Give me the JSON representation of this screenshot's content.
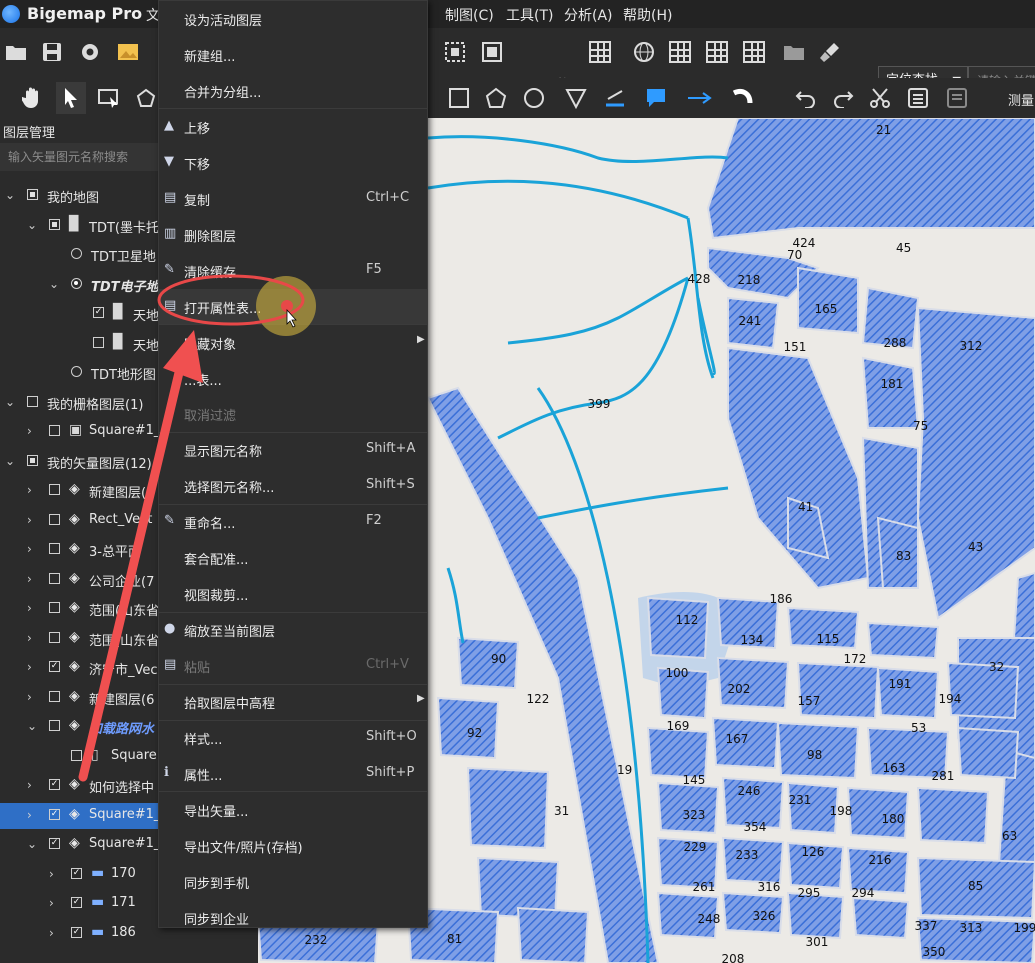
{
  "app": {
    "title": "Bigemap Pro",
    "file_menu_partial": "文"
  },
  "menubar": [
    "制图(C)",
    "工具(T)",
    "分析(A)",
    "帮助(H)"
  ],
  "toolbar": {
    "grid_label": "网格",
    "locate_label": "定位查找",
    "search_placeholder": "请输入关键",
    "measure_label": "测量"
  },
  "layer_panel": {
    "title": "图层管理",
    "search_placeholder": "输入矢量图元名称搜索",
    "rows": [
      {
        "label": "我的地图",
        "level": 0,
        "toggle": "down",
        "check": "partial",
        "icon": ""
      },
      {
        "label": "TDT(墨卡托",
        "level": 1,
        "toggle": "down",
        "check": "partial",
        "icon": "map"
      },
      {
        "label": "TDT卫星地",
        "level": 2,
        "toggle": "",
        "check": "radio",
        "icon": ""
      },
      {
        "label": "TDT电子地",
        "level": 2,
        "toggle": "down",
        "check": "radio-on",
        "icon": "",
        "style": "em"
      },
      {
        "label": "天地",
        "level": 3,
        "toggle": "",
        "check": "checked",
        "icon": "map"
      },
      {
        "label": "天地",
        "level": 3,
        "toggle": "",
        "check": "empty",
        "icon": "map"
      },
      {
        "label": "TDT地形图",
        "level": 2,
        "toggle": "",
        "check": "radio",
        "icon": ""
      },
      {
        "label": "我的栅格图层(1)",
        "level": 0,
        "toggle": "down",
        "check": "empty",
        "icon": ""
      },
      {
        "label": "Square#1_",
        "level": 1,
        "toggle": "right",
        "check": "empty",
        "icon": "img"
      },
      {
        "label": "我的矢量图层(12)",
        "level": 0,
        "toggle": "down",
        "check": "partial",
        "icon": ""
      },
      {
        "label": "新建图层(1",
        "level": 1,
        "toggle": "right",
        "check": "empty",
        "icon": "layers"
      },
      {
        "label": "Rect_Vect",
        "level": 1,
        "toggle": "right",
        "check": "empty",
        "icon": "layers"
      },
      {
        "label": "3-总平面",
        "level": 1,
        "toggle": "right",
        "check": "empty",
        "icon": "layers"
      },
      {
        "label": "公司企业(7",
        "level": 1,
        "toggle": "right",
        "check": "empty",
        "icon": "layers"
      },
      {
        "label": "范围(山东省",
        "level": 1,
        "toggle": "right",
        "check": "empty",
        "icon": "layers"
      },
      {
        "label": "范围(山东省",
        "level": 1,
        "toggle": "right",
        "check": "empty",
        "icon": "layers"
      },
      {
        "label": "济宁市_Vec",
        "level": 1,
        "toggle": "right",
        "check": "checked",
        "icon": "layers"
      },
      {
        "label": "新建图层(6",
        "level": 1,
        "toggle": "right",
        "check": "empty",
        "icon": "layers"
      },
      {
        "label": "加载路网水",
        "level": 1,
        "toggle": "down",
        "check": "empty",
        "icon": "layers",
        "style": "blue"
      },
      {
        "label": "Square",
        "level": 2,
        "toggle": "",
        "check": "empty",
        "icon": "doc"
      },
      {
        "label": "如何选择中",
        "level": 1,
        "toggle": "right",
        "check": "checked",
        "icon": "layers"
      },
      {
        "label": "Square#1_",
        "level": 1,
        "toggle": "right",
        "check": "checked",
        "icon": "layers",
        "selected": true
      },
      {
        "label": "Square#1_",
        "level": 1,
        "toggle": "down",
        "check": "checked",
        "icon": "layers"
      },
      {
        "label": "170",
        "level": 2,
        "toggle": "right",
        "check": "checked",
        "icon": "folder"
      },
      {
        "label": "171",
        "level": 2,
        "toggle": "right",
        "check": "checked",
        "icon": "folder"
      },
      {
        "label": "186",
        "level": 2,
        "toggle": "right",
        "check": "checked",
        "icon": "folder"
      }
    ]
  },
  "context_menu": {
    "items": [
      {
        "label": "设为活动图层",
        "icon": "",
        "shortcut": "",
        "name": "set-active-layer"
      },
      {
        "label": "新建组...",
        "icon": "",
        "shortcut": "",
        "name": "new-group"
      },
      {
        "label": "合并为分组...",
        "icon": "",
        "shortcut": "",
        "name": "merge-group"
      },
      {
        "label": "上移",
        "icon": "▲",
        "shortcut": "",
        "name": "move-up"
      },
      {
        "label": "下移",
        "icon": "▼",
        "shortcut": "",
        "name": "move-down"
      },
      {
        "label": "复制",
        "icon": "▤",
        "shortcut": "Ctrl+C",
        "name": "copy"
      },
      {
        "label": "删除图层",
        "icon": "▥",
        "shortcut": "",
        "name": "delete-layer"
      },
      {
        "label": "清除缓存",
        "icon": "✎",
        "shortcut": "F5",
        "name": "clear-cache"
      },
      {
        "label": "打开属性表...",
        "icon": "▤",
        "shortcut": "",
        "name": "open-attribute-table",
        "hover": true
      },
      {
        "label": "隐藏对象",
        "icon": "",
        "shortcut": "",
        "name": "hide-objects",
        "submenu": true
      },
      {
        "label": "...表...",
        "icon": "",
        "shortcut": "",
        "name": "filter"
      },
      {
        "label": "取消过滤",
        "icon": "",
        "shortcut": "",
        "name": "cancel-filter",
        "disabled": true
      },
      {
        "label": "显示图元名称",
        "icon": "",
        "shortcut": "Shift+A",
        "name": "show-names"
      },
      {
        "label": "选择图元名称...",
        "icon": "",
        "shortcut": "Shift+S",
        "name": "choose-names"
      },
      {
        "label": "重命名...",
        "icon": "✎",
        "shortcut": "F2",
        "name": "rename"
      },
      {
        "label": "套合配准...",
        "icon": "",
        "shortcut": "",
        "name": "registration"
      },
      {
        "label": "视图裁剪...",
        "icon": "",
        "shortcut": "",
        "name": "view-clip"
      },
      {
        "label": "缩放至当前图层",
        "icon": "●",
        "shortcut": "",
        "name": "zoom-to-layer"
      },
      {
        "label": "粘贴",
        "icon": "▤",
        "shortcut": "Ctrl+V",
        "name": "paste",
        "disabled": true
      },
      {
        "label": "拾取图层中高程",
        "icon": "",
        "shortcut": "",
        "name": "pick-elevation",
        "submenu": true
      },
      {
        "label": "样式...",
        "icon": "",
        "shortcut": "Shift+O",
        "name": "style"
      },
      {
        "label": "属性...",
        "icon": "ℹ",
        "shortcut": "Shift+P",
        "name": "properties"
      },
      {
        "label": "导出矢量...",
        "icon": "",
        "shortcut": "",
        "name": "export-vector"
      },
      {
        "label": "导出文件/照片(存档)",
        "icon": "",
        "shortcut": "",
        "name": "export-file"
      },
      {
        "label": "同步到手机",
        "icon": "",
        "shortcut": "",
        "name": "sync-phone"
      },
      {
        "label": "同步到企业",
        "icon": "",
        "shortcut": "",
        "name": "sync-enterprise"
      }
    ]
  },
  "map_labels": [
    "21",
    "424",
    "70",
    "45",
    "428",
    "218",
    "165",
    "241",
    "288",
    "312",
    "151",
    "181",
    "399",
    "75",
    "41",
    "83",
    "43",
    "186",
    "112",
    "134",
    "115",
    "172",
    "32",
    "90",
    "100",
    "202",
    "191",
    "194",
    "122",
    "157",
    "53",
    "92",
    "169",
    "167",
    "98",
    "163",
    "281",
    "19",
    "145",
    "246",
    "231",
    "198",
    "31",
    "323",
    "354",
    "180",
    "63",
    "229",
    "233",
    "126",
    "216",
    "261",
    "316",
    "295",
    "294",
    "85",
    "248",
    "326",
    "232",
    "81",
    "301",
    "337",
    "313",
    "199",
    "350",
    "208"
  ],
  "colors": {
    "accent": "#2f6fc6",
    "parcel": "#3a6fd8",
    "river": "#1aa3d8",
    "annotation": "#e84848"
  }
}
